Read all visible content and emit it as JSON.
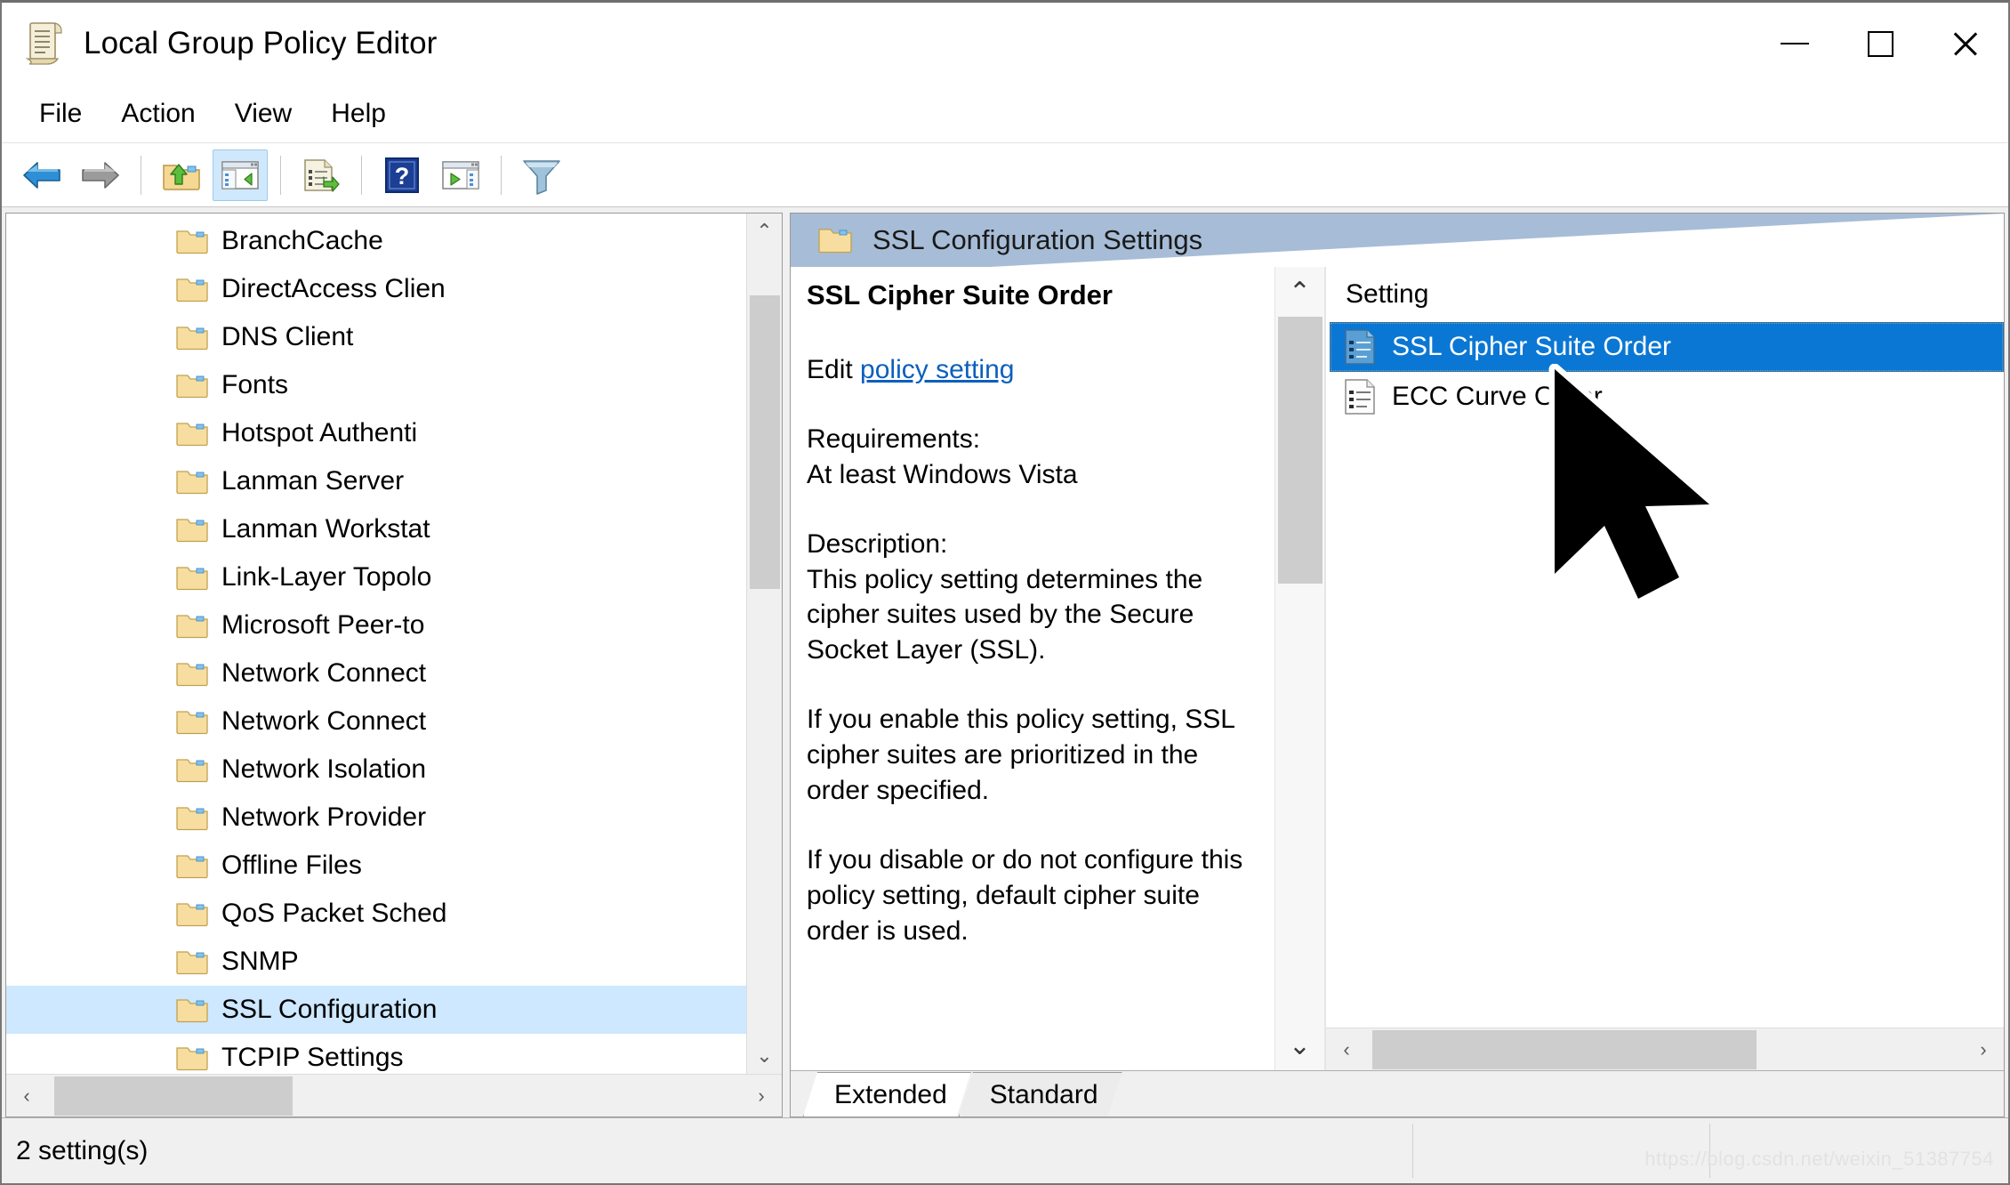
{
  "window": {
    "title": "Local Group Policy Editor",
    "icon": "policy-scroll-icon",
    "controls": {
      "minimize": "—",
      "maximize": "□",
      "close": "✕"
    }
  },
  "menubar": {
    "items": [
      {
        "label": "File"
      },
      {
        "label": "Action"
      },
      {
        "label": "View"
      },
      {
        "label": "Help"
      }
    ]
  },
  "toolbar": {
    "buttons": [
      {
        "name": "back-button",
        "icon": "back-arrow-icon"
      },
      {
        "name": "forward-button",
        "icon": "forward-arrow-icon"
      },
      {
        "name": "up-one-level-button",
        "icon": "folder-up-icon"
      },
      {
        "name": "show-hide-console-tree-button",
        "icon": "console-tree-icon",
        "active": true
      },
      {
        "name": "export-list-button",
        "icon": "export-list-icon"
      },
      {
        "name": "help-button",
        "icon": "help-question-icon"
      },
      {
        "name": "show-hide-action-pane-button",
        "icon": "action-pane-icon"
      },
      {
        "name": "filter-button",
        "icon": "funnel-filter-icon"
      }
    ]
  },
  "tree": {
    "items": [
      {
        "label": "BranchCache",
        "expandable": false,
        "selected": false
      },
      {
        "label": "DirectAccess Clien",
        "expandable": false,
        "selected": false
      },
      {
        "label": "DNS Client",
        "expandable": false,
        "selected": false
      },
      {
        "label": "Fonts",
        "expandable": false,
        "selected": false
      },
      {
        "label": "Hotspot Authenti",
        "expandable": false,
        "selected": false
      },
      {
        "label": "Lanman Server",
        "expandable": false,
        "selected": false
      },
      {
        "label": "Lanman Workstat",
        "expandable": false,
        "selected": false
      },
      {
        "label": "Link-Layer Topolo",
        "expandable": false,
        "selected": false
      },
      {
        "label": "Microsoft Peer-to",
        "expandable": true,
        "selected": false
      },
      {
        "label": "Network Connect",
        "expandable": true,
        "selected": false
      },
      {
        "label": "Network Connect",
        "expandable": false,
        "selected": false
      },
      {
        "label": "Network Isolation",
        "expandable": false,
        "selected": false
      },
      {
        "label": "Network Provider",
        "expandable": false,
        "selected": false
      },
      {
        "label": "Offline Files",
        "expandable": false,
        "selected": false
      },
      {
        "label": "QoS Packet Sched",
        "expandable": true,
        "selected": false
      },
      {
        "label": "SNMP",
        "expandable": false,
        "selected": false
      },
      {
        "label": "SSL Configuration",
        "expandable": false,
        "selected": true
      },
      {
        "label": "TCPIP Settings",
        "expandable": true,
        "selected": false
      }
    ],
    "scroll_up": "⌃",
    "scroll_down": "⌄",
    "scroll_left": "‹",
    "scroll_right": "›"
  },
  "right_pane": {
    "header": {
      "icon": "folder-icon",
      "title": "SSL Configuration Settings"
    },
    "extended": {
      "policy_title": "SSL Cipher Suite Order",
      "edit_prefix": "Edit ",
      "edit_link": "policy setting",
      "requirements_label": "Requirements:",
      "requirements_value": "At least Windows Vista",
      "description_label": "Description:",
      "description_p1": "This policy setting determines the cipher suites used by the Secure Socket Layer (SSL).",
      "description_p2": "If you enable this policy setting, SSL cipher suites are prioritized in the order specified.",
      "description_p3": "If you disable or do not configure this policy setting, default cipher suite order is used.",
      "scroll_up": "⌃",
      "scroll_down": "⌄"
    },
    "list": {
      "column_header": "Setting",
      "rows": [
        {
          "label": "SSL Cipher Suite Order",
          "icon": "policy-setting-icon",
          "selected": true
        },
        {
          "label": "ECC Curve Order",
          "icon": "policy-setting-icon",
          "selected": false
        }
      ],
      "scroll_left": "‹",
      "scroll_right": "›"
    },
    "tabs": [
      {
        "label": "Extended",
        "active": true
      },
      {
        "label": "Standard",
        "active": false
      }
    ]
  },
  "statusbar": {
    "text": "2 setting(s)",
    "watermark": "https://blog.csdn.net/weixin_51387754"
  },
  "colors": {
    "selection_blue": "#0b77d4",
    "tree_selection": "#cde8ff",
    "header_blue": "#a7bcd6",
    "link": "#0b5fbd",
    "toolbar_active": "#cfe8fb"
  },
  "cursor": {
    "name": "mouse-pointer"
  }
}
